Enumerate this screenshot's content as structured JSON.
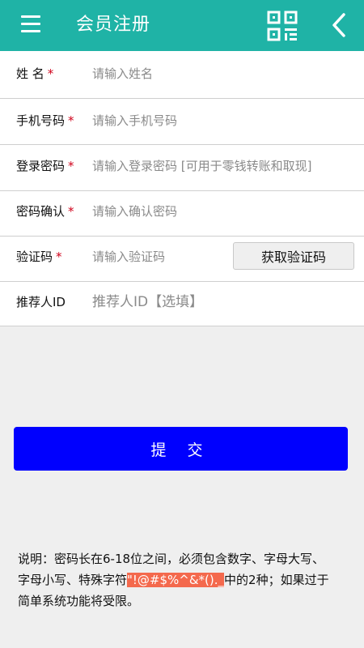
{
  "app_bar": {
    "title": "会员注册",
    "left_icon": "menu-icon",
    "right_icons": [
      "qr-code-icon",
      "back-chevron-icon"
    ],
    "background_color": "#1fb3a6"
  },
  "form": {
    "fields": [
      {
        "label": "姓 名",
        "required": true,
        "placeholder": "请输入姓名"
      },
      {
        "label": "手机号码",
        "required": true,
        "placeholder": "请输入手机号码"
      },
      {
        "label": "登录密码",
        "required": true,
        "placeholder": "请输入登录密码 [可用于零钱转账和取现]"
      },
      {
        "label": "密码确认",
        "required": true,
        "placeholder": "请输入确认密码"
      },
      {
        "label": "验证码",
        "required": true,
        "placeholder": "请输入验证码"
      },
      {
        "label": "推荐人ID",
        "required": false,
        "placeholder": "推荐人ID【选填】"
      }
    ],
    "required_mark": "*",
    "get_code_button": "获取验证码"
  },
  "submit_button": "提 交",
  "submit_color": "#0000fe",
  "note": {
    "before": "说明：密码长在6-18位之间，必须包含数字、字母大写、字母小写、特殊字符",
    "highlight": "\"!@#$%^&*()._",
    "after": "中的2种；如果过于简单系统功能将受限。",
    "highlight_color": "#f4694d"
  }
}
